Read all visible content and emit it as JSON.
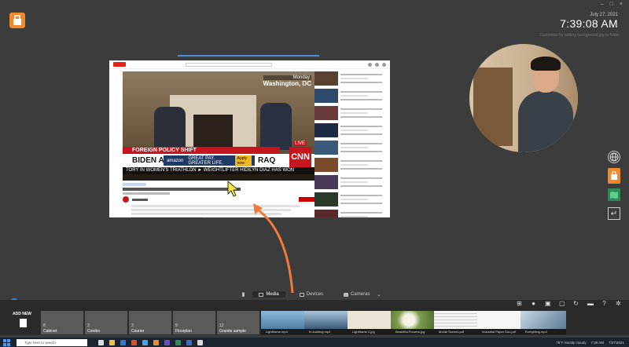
{
  "window": {
    "controls": [
      "–",
      "□",
      "×"
    ]
  },
  "clock": {
    "date": "July 27, 2021",
    "time": "7:39:08 AM"
  },
  "background_hint": "Customize by adding background.jpg to folder",
  "video": {
    "location_small": "Monday",
    "location": "Washington, DC",
    "chyron_top": "FOREIGN POLICY SHIFT",
    "chyron_main": "BIDEN ANNO",
    "chyron_tail": "RAQ",
    "ad_brand": "amazon",
    "ad_text": "GREAT PAY. GREATER LIFE.",
    "ad_button": "Apply now",
    "live": "LIVE",
    "network": "CNN",
    "ticker": "TORY IN WOMEN'S TRIATHLON  ►  WEIGHTLIFTER HIDILYN DIAZ HAS WON"
  },
  "tabs": [
    {
      "label": "Media",
      "icon": "media-icon",
      "active": true
    },
    {
      "label": "Devices",
      "icon": "devices-icon",
      "active": false
    },
    {
      "label": "Cameras",
      "icon": "cameras-icon",
      "active": false
    }
  ],
  "tray": {
    "add_new": "ADD NEW",
    "folders": [
      {
        "count": "8",
        "name": "Cabinet"
      },
      {
        "count": "3",
        "name": "Combo"
      },
      {
        "count": "3",
        "name": "Courier"
      },
      {
        "count": "9",
        "name": "Floorplan"
      },
      {
        "count": "12",
        "name": "Granite sample"
      }
    ],
    "media": [
      {
        "caption": "Lightframe.mp4",
        "color": "#6fa3c9"
      },
      {
        "caption": "In-building.mp4",
        "color": "#4d6d8e"
      },
      {
        "caption": "Lightframe 2.jpg",
        "color": "#e9e2d3"
      },
      {
        "caption": "Beautiful-Flowers.jpg",
        "color": "#7d9a4e"
      },
      {
        "caption": "Modal Scenes.pdf",
        "color": "#f2f2f2"
      },
      {
        "caption": "Industrial Paper Doc.pdf",
        "color": "#f5f5f5"
      },
      {
        "caption": "Everything.mp4",
        "color": "#6b8aa3"
      }
    ]
  },
  "taskbar": {
    "search_placeholder": "Type here to search",
    "weather": "78°F  Mostly cloudy",
    "tray_time": "7:39 AM",
    "tray_date": "7/27/2021"
  }
}
